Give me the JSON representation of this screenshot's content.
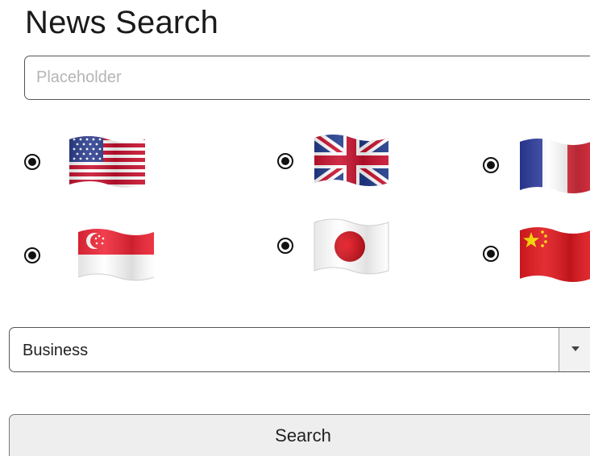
{
  "header": {
    "title": "News Search"
  },
  "search": {
    "placeholder": "Placeholder",
    "value": ""
  },
  "countries": [
    {
      "name": "United States",
      "icon": "us-flag-icon",
      "selected": false
    },
    {
      "name": "United Kingdom",
      "icon": "uk-flag-icon",
      "selected": false
    },
    {
      "name": "France",
      "icon": "france-flag-icon",
      "selected": false
    },
    {
      "name": "Singapore",
      "icon": "singapore-flag-icon",
      "selected": false
    },
    {
      "name": "Japan",
      "icon": "japan-flag-icon",
      "selected": false
    },
    {
      "name": "China",
      "icon": "china-flag-icon",
      "selected": false
    }
  ],
  "category": {
    "selected": "Business",
    "icon": "chevron-down-icon"
  },
  "actions": {
    "search_label": "Search"
  },
  "colors": {
    "radio_fill": "#111111",
    "button_bg": "#eeeeee",
    "border": "#555555",
    "placeholder": "#b5b5b5"
  }
}
